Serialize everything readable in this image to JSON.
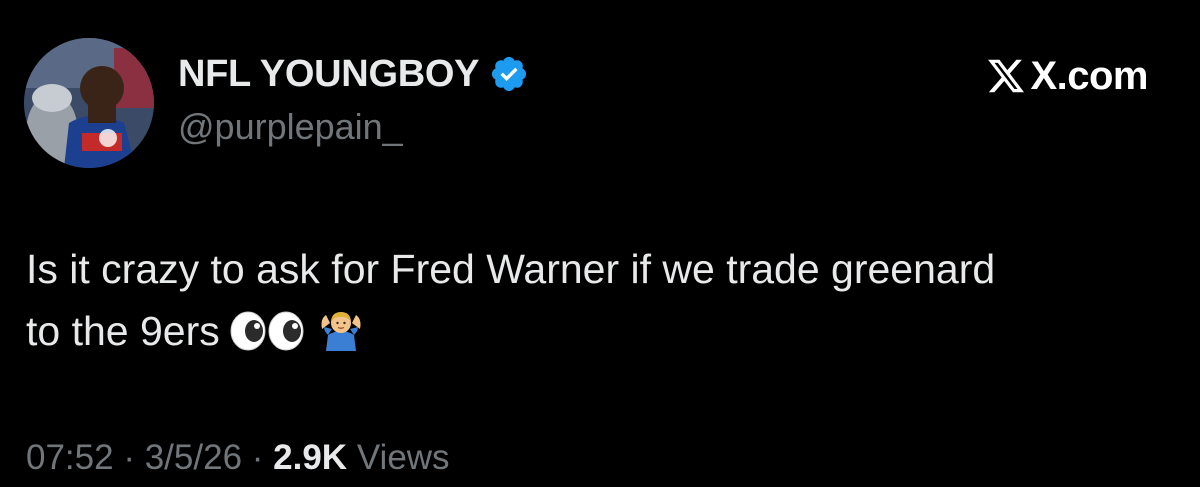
{
  "author": {
    "display_name": "NFL YOUNGBOY",
    "handle": "@purplepain_",
    "verified": true,
    "avatar_icon": "player-avatar"
  },
  "brand": {
    "domain": "X.com",
    "icon": "x-logo-icon"
  },
  "tweet": {
    "line1": "Is it crazy to ask for Fred Warner if we trade greenard",
    "line2": "to the 9ers",
    "emojis": [
      "eyes-emoji",
      "person-shrugging-emoji"
    ]
  },
  "meta": {
    "time": "07:52",
    "sep1": "·",
    "date": "3/5/26",
    "sep2": "·",
    "views_count": "2.9K",
    "views_label": "Views"
  },
  "colors": {
    "background": "#000000",
    "primary_text": "#e7e9ea",
    "secondary_text": "#71767b",
    "verified_blue": "#1d9bf0"
  }
}
